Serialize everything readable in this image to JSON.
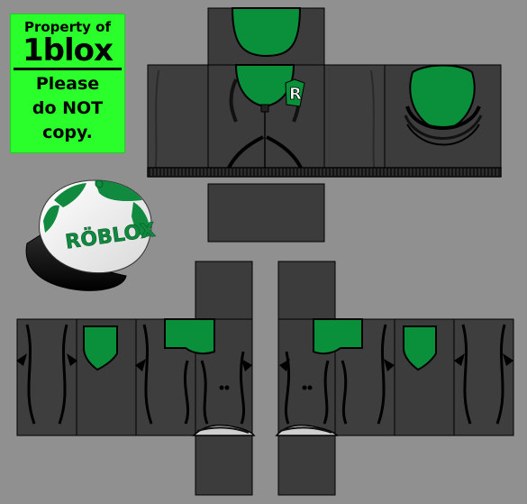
{
  "watermark": {
    "line1": "Property of",
    "brand": "1blox",
    "message_line1": "Please",
    "message_line2": "do NOT",
    "message_line3": "copy."
  },
  "cap": {
    "logo_text": "RÖBLOX",
    "colors": {
      "green": "#0f8a3e",
      "white": "#ffffff",
      "brim": "#111111"
    }
  },
  "template": {
    "colors": {
      "background": "#909090",
      "panel": "#3a3a3a",
      "panel_light": "#4a4a4a",
      "green": "#0a8f3a",
      "outline": "#000000"
    },
    "shirt_logo": "R"
  }
}
